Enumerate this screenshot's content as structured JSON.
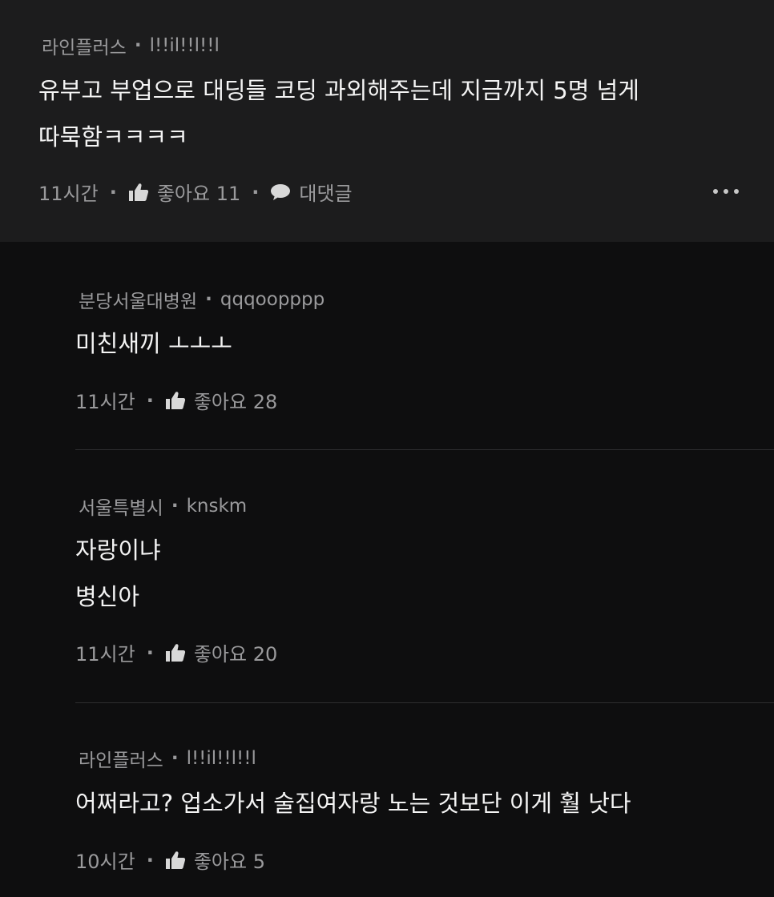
{
  "parent": {
    "author": "라인플러스",
    "username": "l!!il!!l!!l",
    "text_lines": [
      "유부고 부업으로 대딩들 코딩 과외해주는데 지금까지 5명 넘게",
      "따묵함ㅋㅋㅋㅋ"
    ],
    "time": "11시간",
    "likes_label": "좋아요 11",
    "reply_label": "대댓글"
  },
  "replies": [
    {
      "author": "분당서울대병원",
      "username": "qqqoopppp",
      "text_lines": [
        "미친새끼 ㅗㅗㅗ"
      ],
      "time": "11시간",
      "likes_label": "좋아요 28"
    },
    {
      "author": "서울특별시",
      "username": "knskm",
      "text_lines": [
        "자랑이냐",
        "병신아"
      ],
      "time": "11시간",
      "likes_label": "좋아요 20"
    },
    {
      "author": "라인플러스",
      "username": "l!!il!!l!!l",
      "text_lines": [
        "어쩌라고? 업소가서 술집여자랑 노는 것보단 이게 훨 낫다"
      ],
      "time": "10시간",
      "likes_label": "좋아요 5"
    }
  ],
  "icons": {
    "like": "thumbs-up-icon",
    "reply": "speech-bubble-icon",
    "more": "more-horizontal-icon"
  },
  "colors": {
    "parent_bg": "#1c1c1d",
    "reply_bg": "#0e0e0f",
    "meta_text": "#9a9a9c",
    "body_text": "#f4f4f4"
  }
}
